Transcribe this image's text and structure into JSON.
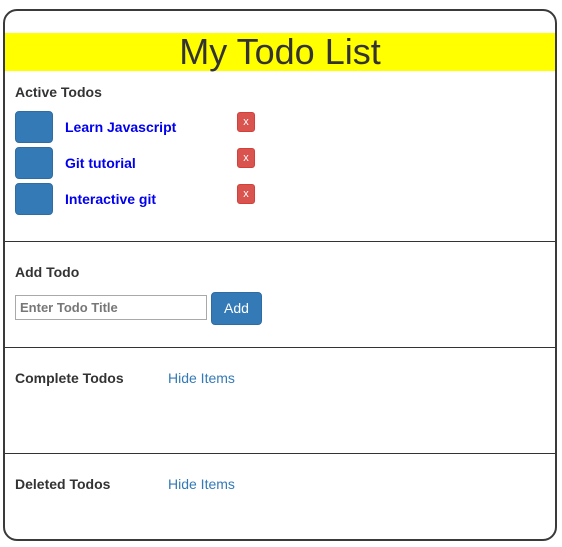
{
  "app": {
    "title": "My Todo List"
  },
  "active": {
    "heading": "Active Todos",
    "items": [
      {
        "title": "Learn Javascript",
        "delete_label": "x"
      },
      {
        "title": "Git tutorial",
        "delete_label": "x"
      },
      {
        "title": "Interactive git",
        "delete_label": "x"
      }
    ]
  },
  "add": {
    "heading": "Add Todo",
    "input_placeholder": "Enter Todo Title",
    "input_value": "",
    "button_label": "Add"
  },
  "complete": {
    "heading": "Complete Todos",
    "toggle_label": "Hide Items"
  },
  "deleted": {
    "heading": "Deleted Todos",
    "toggle_label": "Hide Items"
  },
  "colors": {
    "header_bg": "#ffff00",
    "primary": "#337ab7",
    "danger": "#d9534f",
    "todo_link": "#0000ee"
  }
}
